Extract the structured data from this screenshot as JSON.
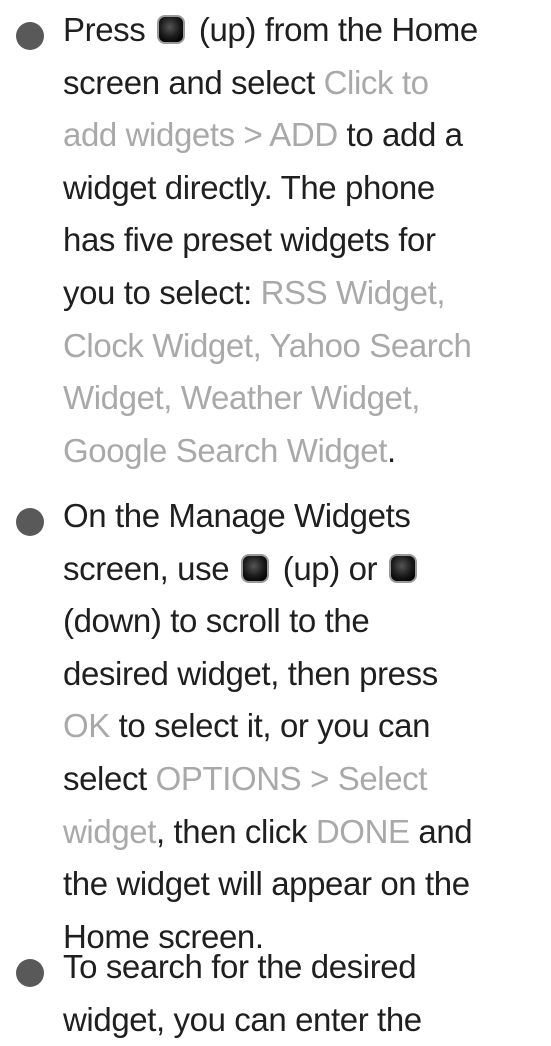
{
  "items": [
    {
      "lines": [
        [
          {
            "t": "Press "
          },
          {
            "icon": "up-key-icon"
          },
          {
            "t": " (up) from the Home"
          }
        ],
        [
          {
            "t": "screen and select "
          },
          {
            "t": "Click to",
            "hl": true
          }
        ],
        [
          {
            "t": "add widgets > ADD",
            "hl": true
          },
          {
            "t": " to add a"
          }
        ],
        [
          {
            "t": "widget directly. The phone"
          }
        ],
        [
          {
            "t": "has five preset widgets for"
          }
        ],
        [
          {
            "t": "you to select: "
          },
          {
            "t": "RSS Widget,",
            "hl": true
          }
        ],
        [
          {
            "t": "Clock Widget, Yahoo Search",
            "hl": true
          }
        ],
        [
          {
            "t": "Widget, Weather Widget,",
            "hl": true
          }
        ],
        [
          {
            "t": "Google Search Widget",
            "hl": true
          },
          {
            "t": "."
          }
        ]
      ]
    },
    {
      "lines": [
        [
          {
            "t": "On the Manage Widgets"
          }
        ],
        [
          {
            "t": "screen, use "
          },
          {
            "icon": "up-key-icon"
          },
          {
            "t": " (up) or "
          },
          {
            "icon": "down-key-icon"
          }
        ],
        [
          {
            "t": "(down) to scroll to the"
          }
        ],
        [
          {
            "t": "desired widget, then press"
          }
        ],
        [
          {
            "t": "OK",
            "hl": true
          },
          {
            "t": " to select it, or you can"
          }
        ],
        [
          {
            "t": "select "
          },
          {
            "t": "OPTIONS > Select",
            "hl": true
          }
        ],
        [
          {
            "t": "widget",
            "hl": true
          },
          {
            "t": ", then click "
          },
          {
            "t": "DONE",
            "hl": true
          },
          {
            "t": " and"
          }
        ],
        [
          {
            "t": "the widget will appear on the"
          }
        ],
        [
          {
            "t": "Home screen."
          }
        ]
      ]
    },
    {
      "lines": [
        [
          {
            "t": "To search for the desired"
          }
        ],
        [
          {
            "t": "widget, you can enter the"
          }
        ]
      ]
    }
  ]
}
